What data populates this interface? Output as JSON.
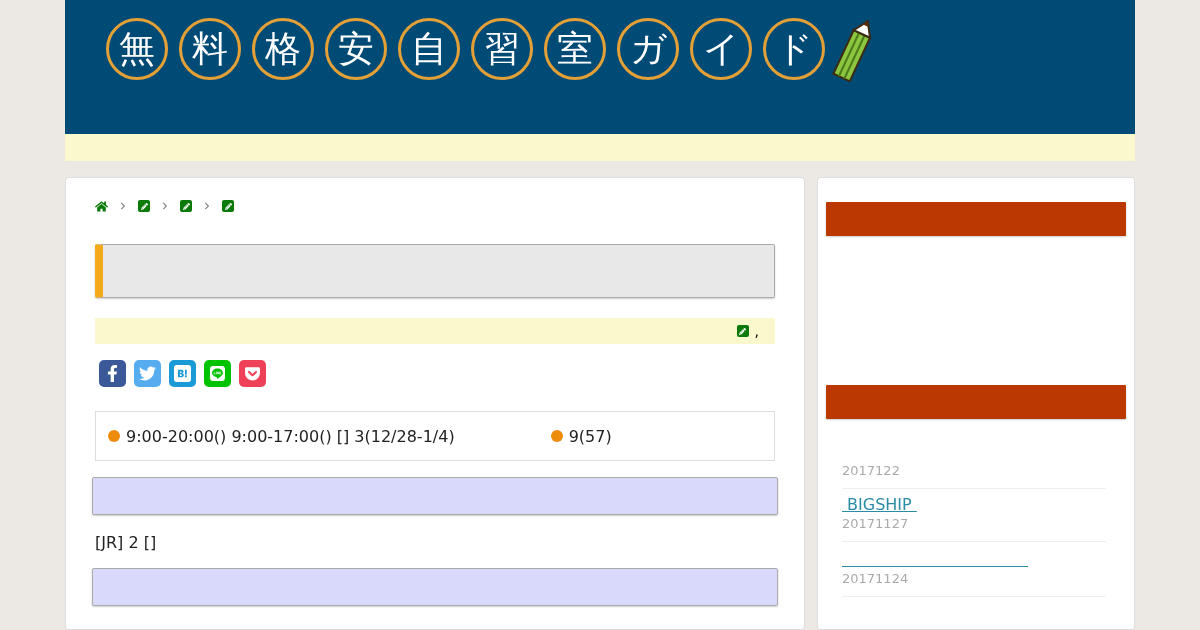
{
  "logo": {
    "characters": [
      "無",
      "料",
      "格",
      "安",
      "自",
      "習",
      "室",
      "ガ",
      "イ",
      "ド"
    ]
  },
  "breadcrumb": [
    {
      "kind": "home"
    },
    {
      "kind": "category"
    },
    {
      "kind": "category"
    },
    {
      "kind": "category"
    }
  ],
  "meta": {
    "text": ","
  },
  "share_buttons": [
    {
      "kind": "facebook"
    },
    {
      "kind": "twitter"
    },
    {
      "kind": "hatena"
    },
    {
      "kind": "line"
    },
    {
      "kind": "pocket"
    }
  ],
  "info_box": {
    "items": [
      "9:00-20:00() 9:00-17:00() [] 3(12/28-1/4)",
      "9(57)"
    ]
  },
  "access_text": "[JR] 2 []",
  "sidebar": {
    "entries": [
      {
        "kind": "date-only",
        "date": "2017122"
      },
      {
        "kind": "link",
        "title": " BIGSHIP ",
        "date": "20171127"
      },
      {
        "kind": "blank-link",
        "date": "20171124"
      }
    ]
  }
}
